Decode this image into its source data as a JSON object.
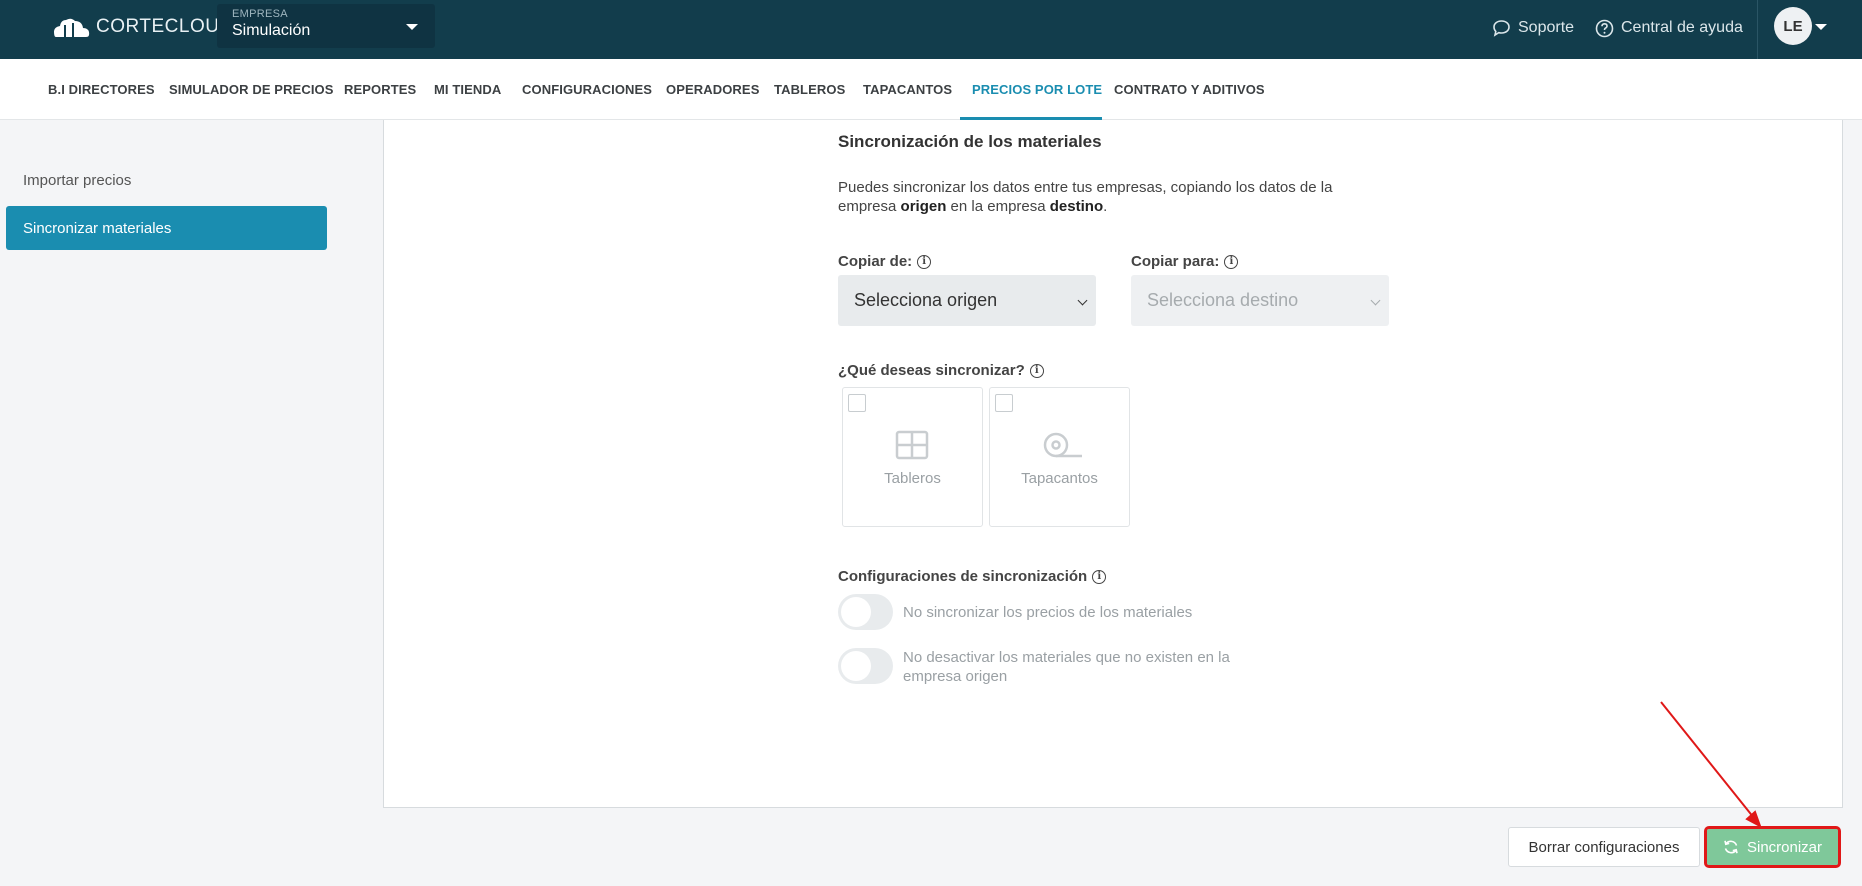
{
  "header": {
    "logo_text": "CORTECLOUD",
    "company_label": "EMPRESA",
    "company_value": "Simulación",
    "support": "Soporte",
    "help": "Central de ayuda",
    "avatar": "LE"
  },
  "nav": {
    "items": [
      "B.I DIRECTORES",
      "SIMULADOR DE PRECIOS",
      "REPORTES",
      "MI TIENDA",
      "CONFIGURACIONES",
      "OPERADORES",
      "TABLEROS",
      "TAPACANTOS",
      "PRECIOS POR LOTE",
      "CONTRATO Y ADITIVOS"
    ],
    "active": "PRECIOS POR LOTE"
  },
  "sidebar": {
    "items": [
      "Importar precios",
      "Sincronizar materiales"
    ],
    "active": "Sincronizar materiales"
  },
  "main": {
    "title": "Sincronización de los materiales",
    "desc_1": "Puedes sincronizar los datos entre tus empresas, copiando los datos de la empresa ",
    "desc_bold_1": "origen",
    "desc_2": " en la empresa ",
    "desc_bold_2": "destino",
    "desc_3": ".",
    "copy_from_label": "Copiar de:",
    "copy_from_placeholder": "Selecciona origen",
    "copy_to_label": "Copiar para:",
    "copy_to_placeholder": "Selecciona destino",
    "what_label": "¿Qué deseas sincronizar?",
    "options": [
      "Tableros",
      "Tapacantos"
    ],
    "config_label": "Configuraciones de sincronización",
    "toggle_1": "No sincronizar los precios de los materiales",
    "toggle_2": "No desactivar los materiales que no existen en la empresa origen"
  },
  "footer": {
    "clear_button": "Borrar configuraciones",
    "sync_button": "Sincronizar"
  },
  "colors": {
    "topbar": "#123d4c",
    "accent": "#1a8db0",
    "sync_button": "#7fc89a",
    "annotation": "#e01818"
  }
}
